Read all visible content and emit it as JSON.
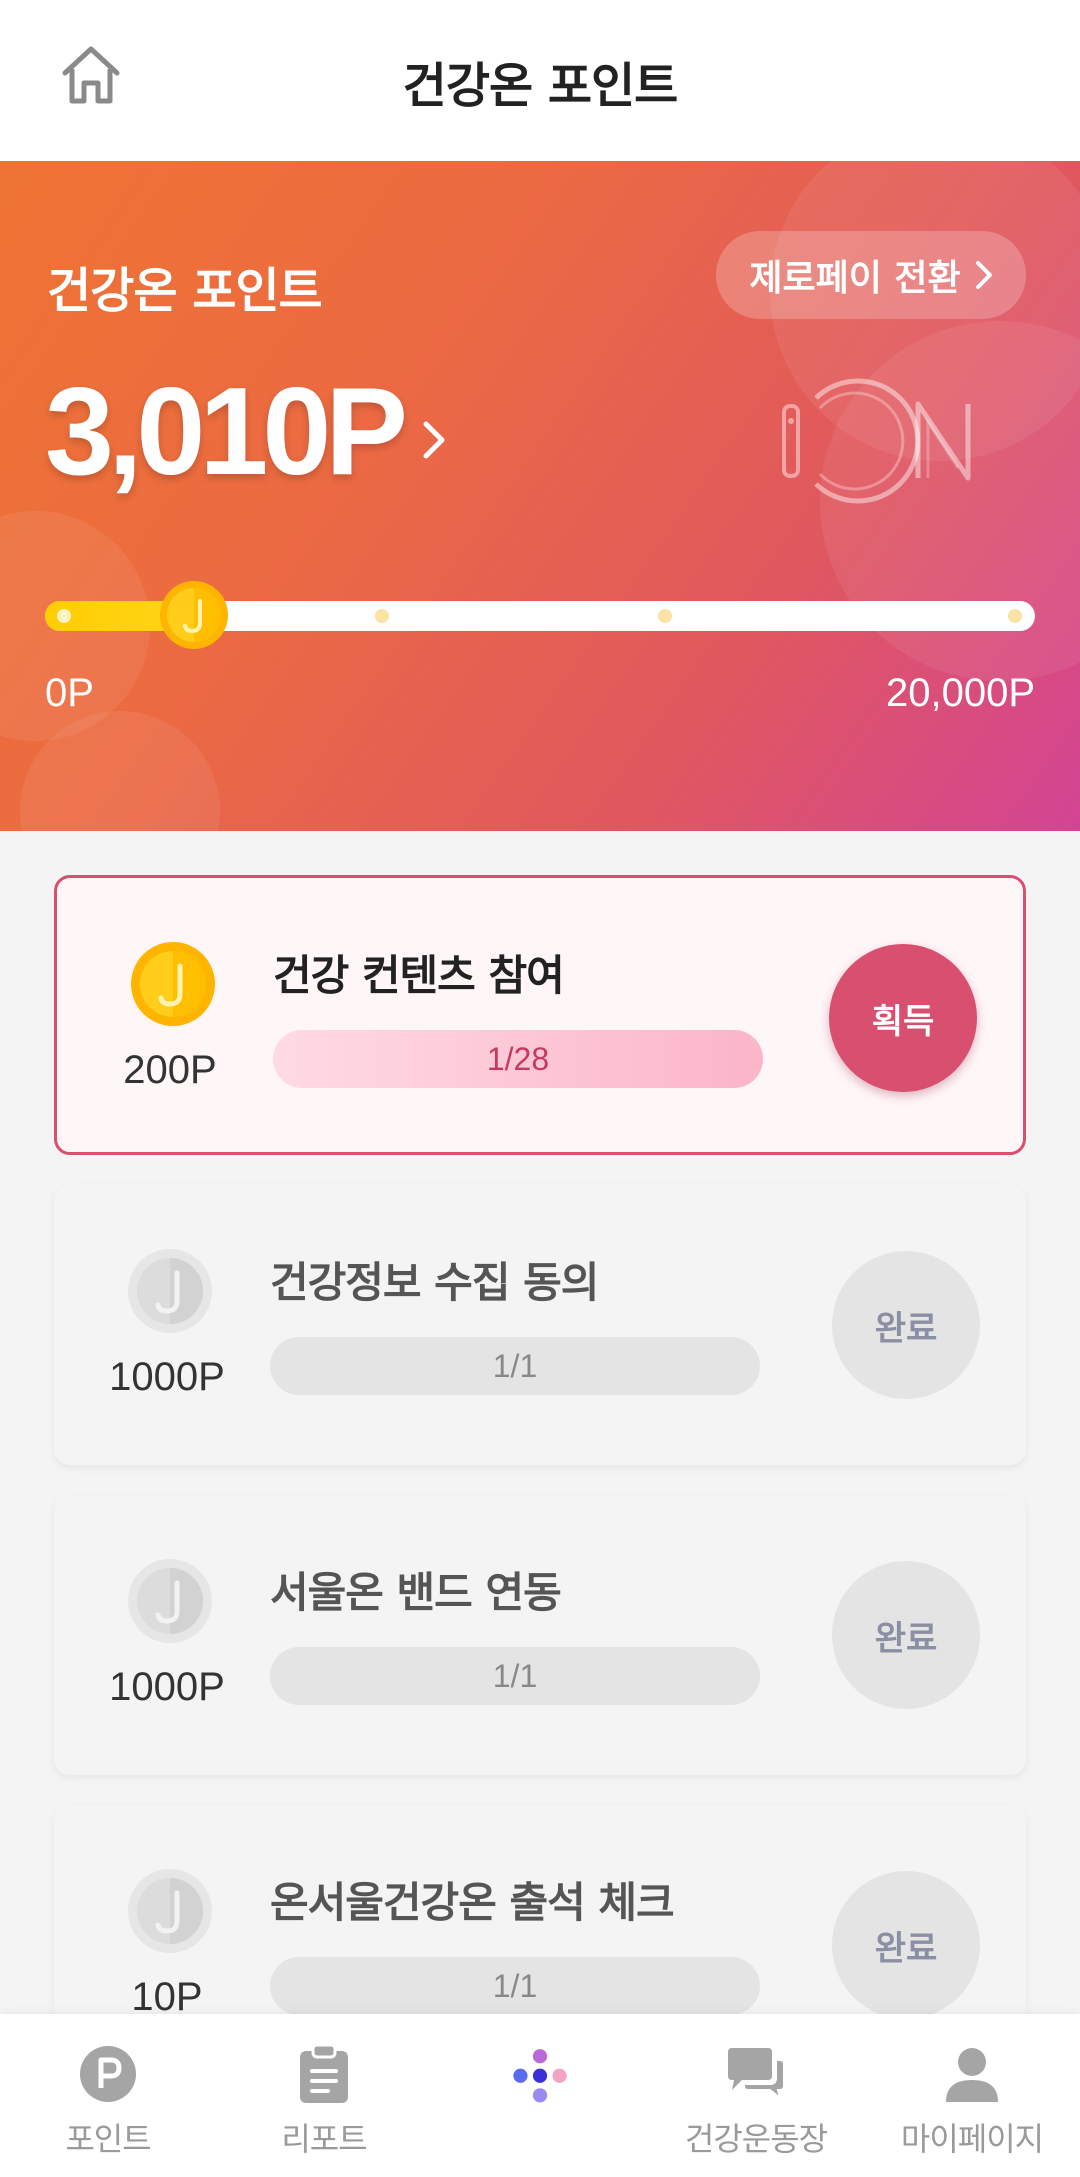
{
  "header": {
    "title": "건강온 포인트",
    "home_icon": "home-icon"
  },
  "hero": {
    "title": "건강온 포인트",
    "switch_label": "제로페이 전환",
    "points": "3,010P",
    "range_min": "0P",
    "range_max": "20,000P",
    "progress_current": 3010,
    "progress_max": 20000,
    "logo_icon": "on-logo"
  },
  "tasks": [
    {
      "title": "건강 컨텐츠 참여",
      "points": "200P",
      "progress": "1/28",
      "button": "획득",
      "state": "active"
    },
    {
      "title": "건강정보 수집 동의",
      "points": "1000P",
      "progress": "1/1",
      "button": "완료",
      "state": "done"
    },
    {
      "title": "서울온 밴드 연동",
      "points": "1000P",
      "progress": "1/1",
      "button": "완료",
      "state": "done"
    },
    {
      "title": "온서울건강온 출석 체크",
      "points": "10P",
      "progress": "1/1",
      "button": "완료",
      "state": "done"
    }
  ],
  "nav": [
    {
      "label": "포인트",
      "icon": "points-icon"
    },
    {
      "label": "리포트",
      "icon": "report-icon"
    },
    {
      "label": "",
      "icon": "home-dots-icon"
    },
    {
      "label": "건강운동장",
      "icon": "chat-icon"
    },
    {
      "label": "마이페이지",
      "icon": "profile-icon"
    }
  ],
  "colors": {
    "accent": "#d94f70",
    "hero_start": "#ee7433",
    "hero_end": "#d34494",
    "coin": "#ffcd00"
  }
}
